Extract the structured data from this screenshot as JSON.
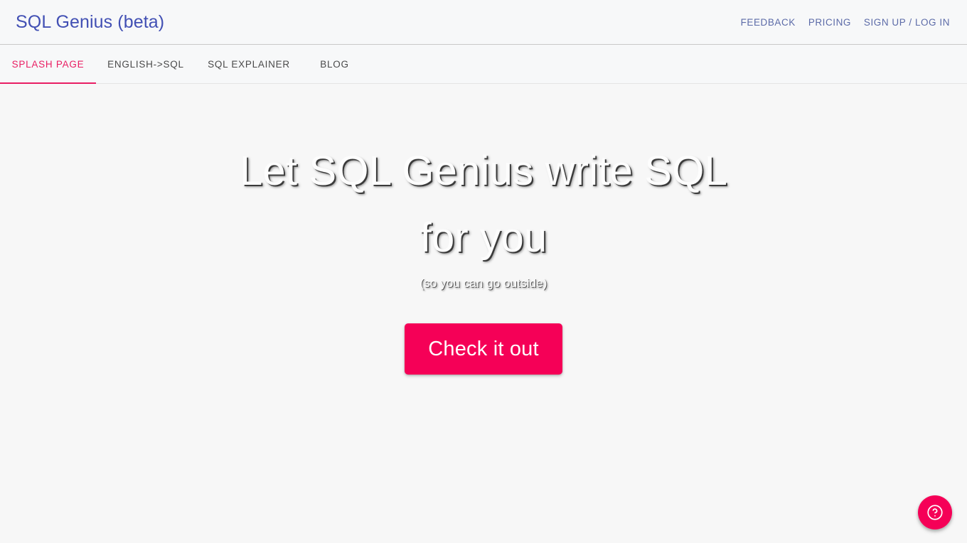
{
  "header": {
    "brand": "SQL Genius (beta)",
    "links": [
      {
        "label": "FEEDBACK",
        "name": "header-link-feedback"
      },
      {
        "label": "PRICING",
        "name": "header-link-pricing"
      },
      {
        "label": "SIGN UP / LOG IN",
        "name": "header-link-signup-login"
      }
    ]
  },
  "tabs": [
    {
      "label": "SPLASH PAGE",
      "active": true
    },
    {
      "label": "ENGLISH->SQL",
      "active": false
    },
    {
      "label": "SQL EXPLAINER",
      "active": false
    },
    {
      "label": "BLOG",
      "active": false
    }
  ],
  "hero": {
    "title_line1": "Let SQL Genius write SQL for",
    "title_line2": "you",
    "subtitle": "(so you can go outside)",
    "cta_label": "Check it out"
  },
  "help": {
    "icon": "help-circle-icon"
  },
  "colors": {
    "accent_pink": "#f50057",
    "tab_active": "#e91e63",
    "brand_indigo": "#4250b4",
    "nav_link": "#5c6ba8",
    "page_background": "#f7f7f7"
  }
}
